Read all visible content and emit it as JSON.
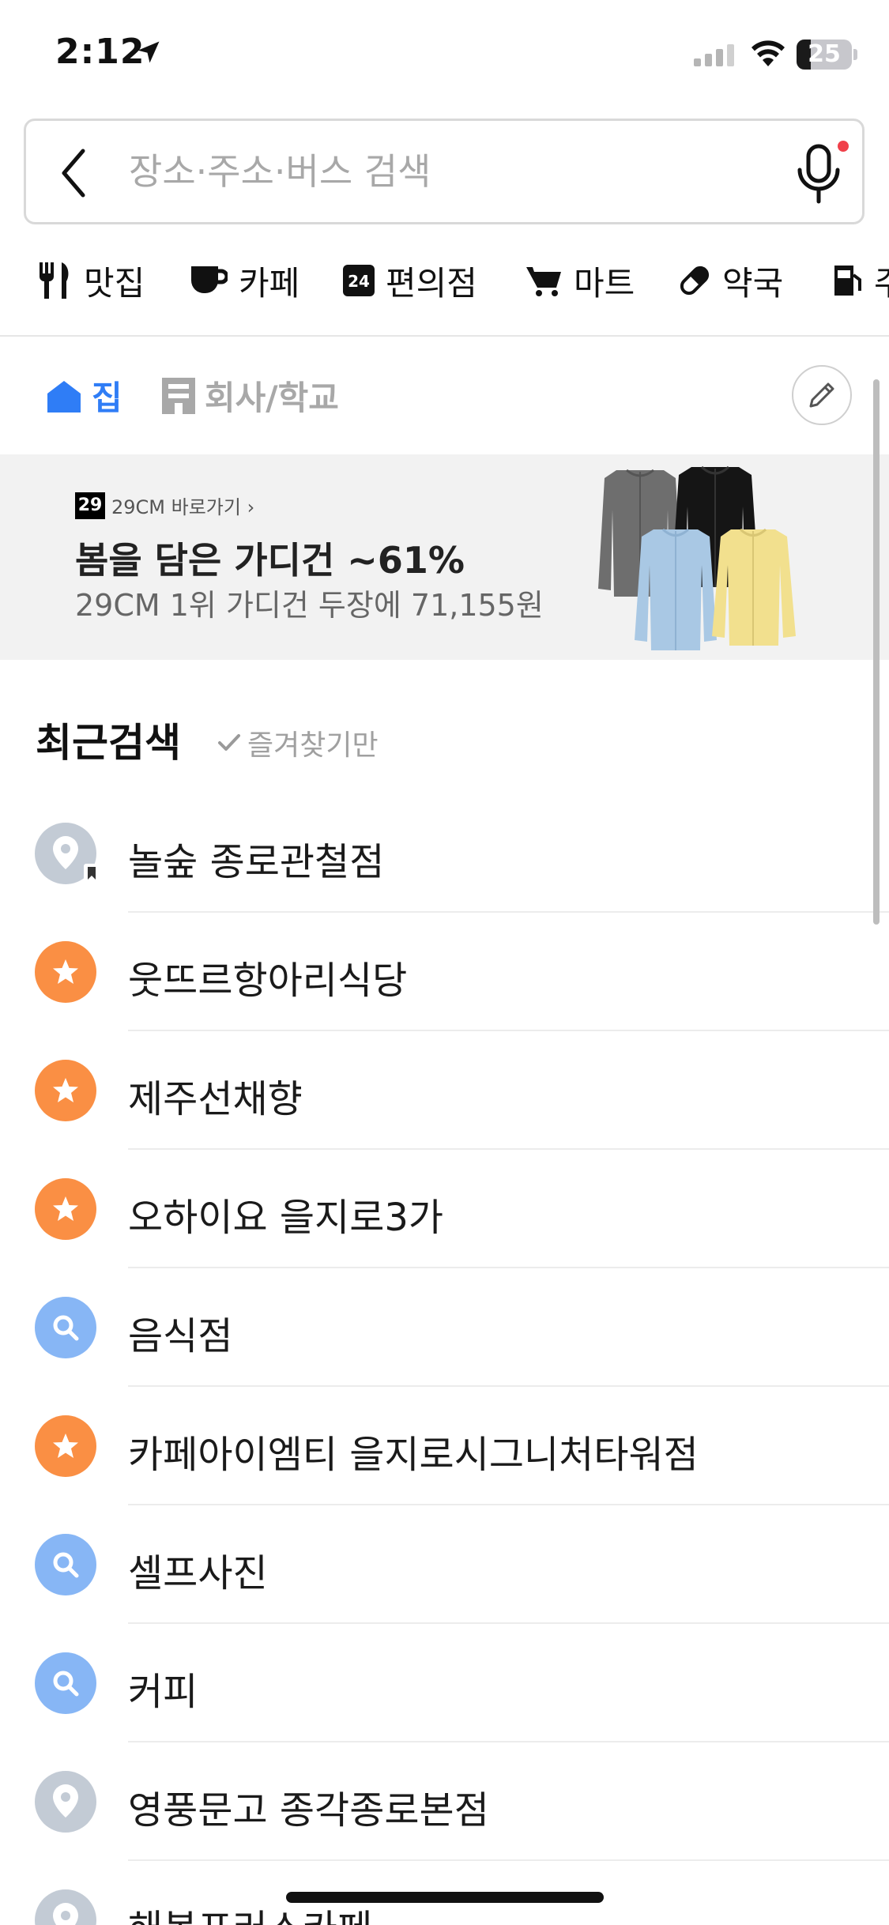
{
  "status_bar": {
    "time": "2:12",
    "battery": "25",
    "battery_level": 0.25
  },
  "search": {
    "placeholder": "장소·주소·버스 검색"
  },
  "categories": [
    {
      "icon": "restaurant-icon",
      "label": "맛집"
    },
    {
      "icon": "cafe-cup-icon",
      "label": "카페"
    },
    {
      "icon": "convenience-24-icon",
      "label": "편의점"
    },
    {
      "icon": "shopping-cart-icon",
      "label": "마트"
    },
    {
      "icon": "pill-icon",
      "label": "약국"
    },
    {
      "icon": "gas-station-icon",
      "label": "주"
    }
  ],
  "place_tabs": {
    "home": "집",
    "work": "회사/학교"
  },
  "banner": {
    "brand_logo": "29",
    "brand_link": "29CM 바로가기 ›",
    "title": "봄을 담은 가디건 ~61%",
    "subtitle": "29CM 1위 가디건 두장에 71,155원"
  },
  "recent": {
    "title": "최근검색",
    "filter_label": "즐겨찾기만",
    "items": [
      {
        "type": "place",
        "label": "놀숲 종로관철점"
      },
      {
        "type": "star",
        "label": "웃뜨르항아리식당"
      },
      {
        "type": "star",
        "label": "제주선채향"
      },
      {
        "type": "star",
        "label": "오하이요 을지로3가"
      },
      {
        "type": "search",
        "label": "음식점"
      },
      {
        "type": "star",
        "label": "카페아이엠티 을지로시그니처타워점"
      },
      {
        "type": "search",
        "label": "셀프사진"
      },
      {
        "type": "search",
        "label": "커피"
      },
      {
        "type": "place",
        "label": "영풍문고 종각종로본점"
      },
      {
        "type": "place",
        "label": "해봉프러스카페"
      }
    ]
  },
  "colors": {
    "accent_blue": "#2f7df6",
    "star_orange": "#fa8f44",
    "search_blue": "#87b6f5",
    "place_gray": "#c3cbd5",
    "mic_dot_red": "#f0404a"
  }
}
